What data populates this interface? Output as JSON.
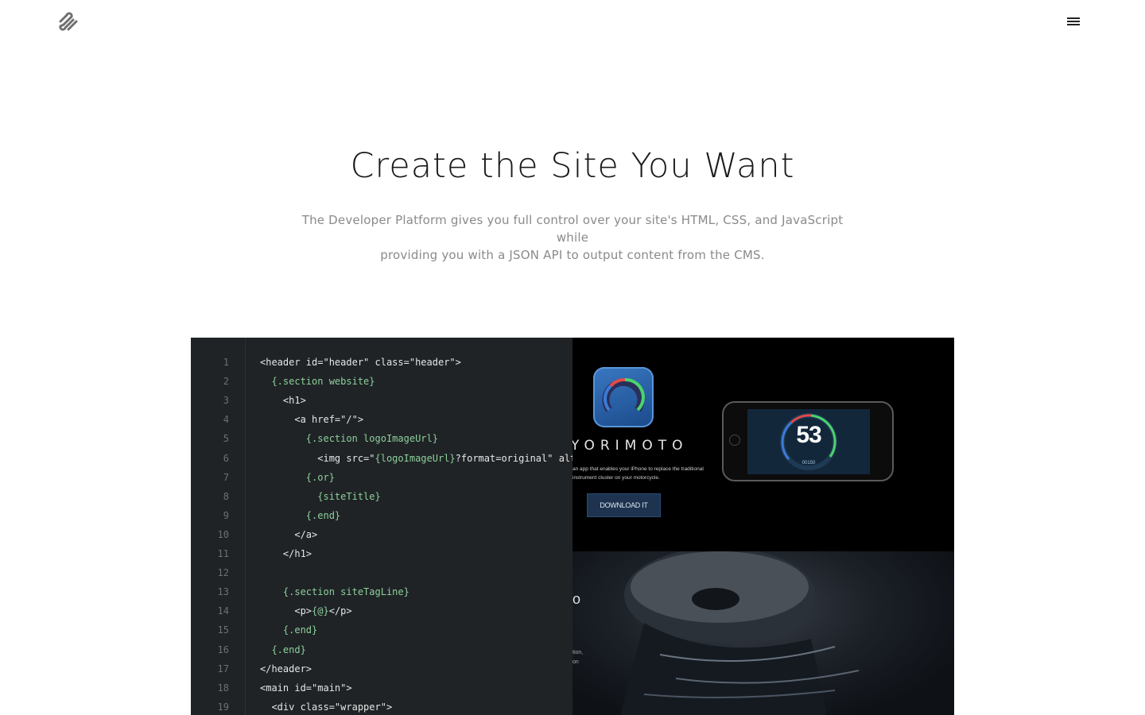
{
  "header": {
    "logo_icon": "squarespace-logo-icon",
    "menu_icon": "hamburger-menu-icon"
  },
  "hero": {
    "title": "Create the Site You Want",
    "subtitle_line1": "The Developer Platform gives you full control over your site's HTML, CSS, and JavaScript while",
    "subtitle_line2": "providing you with a JSON API to output content from the CMS."
  },
  "code_editor": {
    "lines": [
      {
        "num": "1",
        "indent": "",
        "parts": [
          {
            "t": "<header id=\"header\" class=\"header\">",
            "k": "html"
          }
        ]
      },
      {
        "num": "2",
        "indent": "  ",
        "parts": [
          {
            "t": "{.section website}",
            "k": "tpl"
          }
        ]
      },
      {
        "num": "3",
        "indent": "    ",
        "parts": [
          {
            "t": "<h1>",
            "k": "html"
          }
        ]
      },
      {
        "num": "4",
        "indent": "      ",
        "parts": [
          {
            "t": "<a href=\"/\">",
            "k": "html"
          }
        ]
      },
      {
        "num": "5",
        "indent": "        ",
        "parts": [
          {
            "t": "{.section logoImageUrl}",
            "k": "tpl"
          }
        ]
      },
      {
        "num": "6",
        "indent": "          ",
        "parts": [
          {
            "t": "<img src=\"",
            "k": "html"
          },
          {
            "t": "{logoImageUrl}",
            "k": "tpl"
          },
          {
            "t": "?format=original\" alt=\"{",
            "k": "html"
          }
        ]
      },
      {
        "num": "7",
        "indent": "        ",
        "parts": [
          {
            "t": "{.or}",
            "k": "tpl"
          }
        ]
      },
      {
        "num": "8",
        "indent": "          ",
        "parts": [
          {
            "t": "{siteTitle}",
            "k": "tpl"
          }
        ]
      },
      {
        "num": "9",
        "indent": "        ",
        "parts": [
          {
            "t": "{.end}",
            "k": "tpl"
          }
        ]
      },
      {
        "num": "10",
        "indent": "      ",
        "parts": [
          {
            "t": "</a>",
            "k": "html"
          }
        ]
      },
      {
        "num": "11",
        "indent": "    ",
        "parts": [
          {
            "t": "</h1>",
            "k": "html"
          }
        ]
      },
      {
        "num": "12",
        "indent": "",
        "parts": []
      },
      {
        "num": "13",
        "indent": "    ",
        "parts": [
          {
            "t": "{.section siteTagLine}",
            "k": "tpl"
          }
        ]
      },
      {
        "num": "14",
        "indent": "      ",
        "parts": [
          {
            "t": "<p>",
            "k": "html"
          },
          {
            "t": "{@}",
            "k": "tpl"
          },
          {
            "t": "</p>",
            "k": "html"
          }
        ]
      },
      {
        "num": "15",
        "indent": "    ",
        "parts": [
          {
            "t": "{.end}",
            "k": "tpl"
          }
        ]
      },
      {
        "num": "16",
        "indent": "  ",
        "parts": [
          {
            "t": "{.end}",
            "k": "tpl"
          }
        ]
      },
      {
        "num": "17",
        "indent": "",
        "parts": [
          {
            "t": "</header>",
            "k": "html"
          }
        ]
      },
      {
        "num": "18",
        "indent": "",
        "parts": [
          {
            "t": "<main id=\"main\">",
            "k": "html"
          }
        ]
      },
      {
        "num": "19",
        "indent": "  ",
        "parts": [
          {
            "t": "<div class=\"wrapper\">",
            "k": "html"
          }
        ]
      }
    ]
  },
  "preview": {
    "app_name": "YORIMOTO",
    "app_desc_line1": "an app that enables your iPhone to replace the traditional",
    "app_desc_line2": "instrument cluster on your motorcycle.",
    "download_label": "DOWNLOAD IT",
    "speed": "53",
    "odometer": "00150",
    "fragment_char": "o",
    "fragment_line1": "tion,",
    "fragment_line2": "on"
  },
  "colors": {
    "background": "#ffffff",
    "title": "#1a1a1a",
    "subtitle": "#8a8a8a",
    "editor_bg": "#1f2326",
    "template_token": "#8ecf9b",
    "download_btn": "#1d3350"
  }
}
